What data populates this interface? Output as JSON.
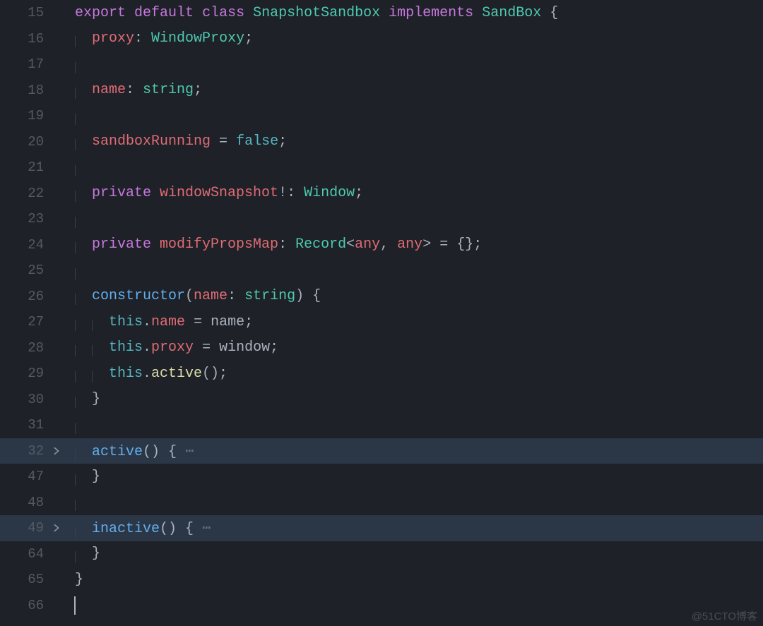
{
  "watermark": "@51CTO博客",
  "colors": {
    "background": "#1e2127",
    "gutter": "#555a63",
    "highlight": "#2b3747",
    "keyword": "#c678dd",
    "type": "#4ec9b0",
    "property": "#e06c75",
    "function": "#61afef",
    "boolean": "#56b6c2",
    "this": "#56b6c2",
    "default": "#abb2bf"
  },
  "lines": [
    {
      "num": "15",
      "folded": false,
      "hl": false,
      "tokens": [
        [
          "kw",
          "export"
        ],
        [
          "sp",
          " "
        ],
        [
          "kw",
          "default"
        ],
        [
          "sp",
          " "
        ],
        [
          "kw",
          "class"
        ],
        [
          "sp",
          " "
        ],
        [
          "type",
          "SnapshotSandbox"
        ],
        [
          "sp",
          " "
        ],
        [
          "kw",
          "implements"
        ],
        [
          "sp",
          " "
        ],
        [
          "type",
          "SandBox"
        ],
        [
          "sp",
          " "
        ],
        [
          "punc",
          "{"
        ]
      ]
    },
    {
      "num": "16",
      "folded": false,
      "hl": false,
      "indent": 1,
      "tokens": [
        [
          "prop",
          "proxy"
        ],
        [
          "punc",
          ":"
        ],
        [
          "sp",
          " "
        ],
        [
          "type",
          "WindowProxy"
        ],
        [
          "punc",
          ";"
        ]
      ]
    },
    {
      "num": "17",
      "folded": false,
      "hl": false,
      "indent": 1,
      "tokens": []
    },
    {
      "num": "18",
      "folded": false,
      "hl": false,
      "indent": 1,
      "tokens": [
        [
          "prop",
          "name"
        ],
        [
          "punc",
          ":"
        ],
        [
          "sp",
          " "
        ],
        [
          "type",
          "string"
        ],
        [
          "punc",
          ";"
        ]
      ]
    },
    {
      "num": "19",
      "folded": false,
      "hl": false,
      "indent": 1,
      "tokens": []
    },
    {
      "num": "20",
      "folded": false,
      "hl": false,
      "indent": 1,
      "tokens": [
        [
          "prop",
          "sandboxRunning"
        ],
        [
          "sp",
          " "
        ],
        [
          "op",
          "="
        ],
        [
          "sp",
          " "
        ],
        [
          "bool",
          "false"
        ],
        [
          "punc",
          ";"
        ]
      ]
    },
    {
      "num": "21",
      "folded": false,
      "hl": false,
      "indent": 1,
      "tokens": []
    },
    {
      "num": "22",
      "folded": false,
      "hl": false,
      "indent": 1,
      "tokens": [
        [
          "kw",
          "private"
        ],
        [
          "sp",
          " "
        ],
        [
          "varw",
          "windowSnapshot"
        ],
        [
          "op",
          "!"
        ],
        [
          "punc",
          ":"
        ],
        [
          "sp",
          " "
        ],
        [
          "type",
          "Window"
        ],
        [
          "punc",
          ";"
        ]
      ]
    },
    {
      "num": "23",
      "folded": false,
      "hl": false,
      "indent": 1,
      "tokens": []
    },
    {
      "num": "24",
      "folded": false,
      "hl": false,
      "indent": 1,
      "tokens": [
        [
          "kw",
          "private"
        ],
        [
          "sp",
          " "
        ],
        [
          "varw",
          "modifyPropsMap"
        ],
        [
          "punc",
          ":"
        ],
        [
          "sp",
          " "
        ],
        [
          "type",
          "Record"
        ],
        [
          "punc",
          "<"
        ],
        [
          "prop",
          "any"
        ],
        [
          "punc",
          ","
        ],
        [
          "sp",
          " "
        ],
        [
          "prop",
          "any"
        ],
        [
          "punc",
          ">"
        ],
        [
          "sp",
          " "
        ],
        [
          "op",
          "="
        ],
        [
          "sp",
          " "
        ],
        [
          "punc",
          "{};"
        ]
      ]
    },
    {
      "num": "25",
      "folded": false,
      "hl": false,
      "indent": 1,
      "tokens": []
    },
    {
      "num": "26",
      "folded": false,
      "hl": false,
      "indent": 1,
      "tokens": [
        [
          "fn",
          "constructor"
        ],
        [
          "punc",
          "("
        ],
        [
          "prop",
          "name"
        ],
        [
          "punc",
          ":"
        ],
        [
          "sp",
          " "
        ],
        [
          "type",
          "string"
        ],
        [
          "punc",
          ")"
        ],
        [
          "sp",
          " "
        ],
        [
          "punc",
          "{"
        ]
      ]
    },
    {
      "num": "27",
      "folded": false,
      "hl": false,
      "indent": 2,
      "tokens": [
        [
          "ths",
          "this"
        ],
        [
          "punc",
          "."
        ],
        [
          "prop",
          "name"
        ],
        [
          "sp",
          " "
        ],
        [
          "op",
          "="
        ],
        [
          "sp",
          " "
        ],
        [
          "punc",
          "name;"
        ]
      ]
    },
    {
      "num": "28",
      "folded": false,
      "hl": false,
      "indent": 2,
      "tokens": [
        [
          "ths",
          "this"
        ],
        [
          "punc",
          "."
        ],
        [
          "prop",
          "proxy"
        ],
        [
          "sp",
          " "
        ],
        [
          "op",
          "="
        ],
        [
          "sp",
          " "
        ],
        [
          "punc",
          "window;"
        ]
      ]
    },
    {
      "num": "29",
      "folded": false,
      "hl": false,
      "indent": 2,
      "tokens": [
        [
          "ths",
          "this"
        ],
        [
          "punc",
          "."
        ],
        [
          "call",
          "active"
        ],
        [
          "punc",
          "();"
        ]
      ]
    },
    {
      "num": "30",
      "folded": false,
      "hl": false,
      "indent": 1,
      "tokens": [
        [
          "punc",
          "}"
        ]
      ]
    },
    {
      "num": "31",
      "folded": false,
      "hl": false,
      "indent": 1,
      "tokens": []
    },
    {
      "num": "32",
      "folded": true,
      "hl": true,
      "indent": 1,
      "tokens": [
        [
          "fn",
          "active"
        ],
        [
          "punc",
          "()"
        ],
        [
          "sp",
          " "
        ],
        [
          "punc",
          "{"
        ],
        [
          "fold-dots",
          " ⋯"
        ]
      ]
    },
    {
      "num": "47",
      "folded": false,
      "hl": false,
      "indent": 1,
      "tokens": [
        [
          "punc",
          "}"
        ]
      ]
    },
    {
      "num": "48",
      "folded": false,
      "hl": false,
      "indent": 1,
      "tokens": []
    },
    {
      "num": "49",
      "folded": true,
      "hl": true,
      "indent": 1,
      "tokens": [
        [
          "fn",
          "inactive"
        ],
        [
          "punc",
          "()"
        ],
        [
          "sp",
          " "
        ],
        [
          "punc",
          "{"
        ],
        [
          "fold-dots",
          " ⋯"
        ]
      ]
    },
    {
      "num": "64",
      "folded": false,
      "hl": false,
      "indent": 1,
      "tokens": [
        [
          "punc",
          "}"
        ]
      ]
    },
    {
      "num": "65",
      "folded": false,
      "hl": false,
      "tokens": [
        [
          "punc",
          "}"
        ]
      ]
    },
    {
      "num": "66",
      "folded": false,
      "hl": false,
      "cursor": true,
      "tokens": []
    }
  ]
}
